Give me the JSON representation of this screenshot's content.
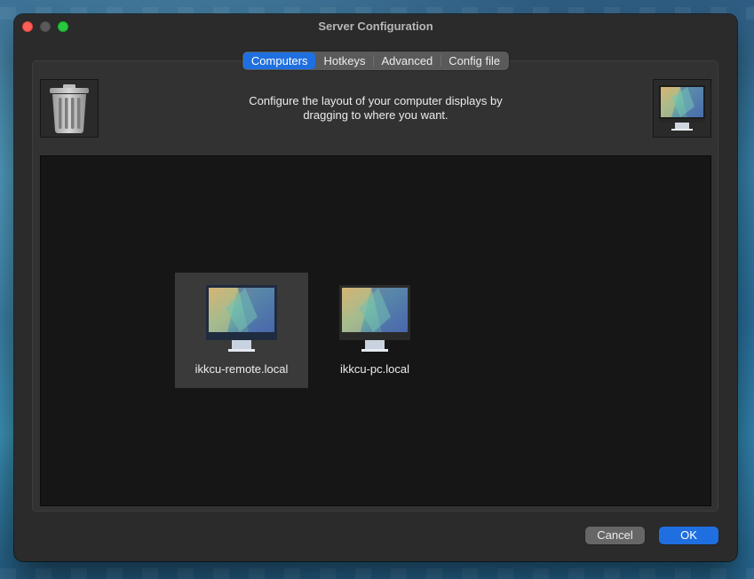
{
  "window": {
    "title": "Server Configuration"
  },
  "tabs": [
    {
      "label": "Computers",
      "active": true
    },
    {
      "label": "Hotkeys",
      "active": false
    },
    {
      "label": "Advanced",
      "active": false
    },
    {
      "label": "Config file",
      "active": false
    }
  ],
  "instructions": {
    "line1": "Configure the layout of your computer displays by",
    "line2": "dragging to where you want."
  },
  "icons": {
    "trash": "trash-icon",
    "new_screen": "monitor-icon"
  },
  "screens": [
    {
      "name": "ikkcu-remote.local",
      "selected": true
    },
    {
      "name": "ikkcu-pc.local",
      "selected": false
    }
  ],
  "buttons": {
    "cancel": "Cancel",
    "ok": "OK"
  },
  "colors": {
    "accent": "#1f6fe0",
    "close": "#ff5f57",
    "zoom": "#28c840"
  }
}
